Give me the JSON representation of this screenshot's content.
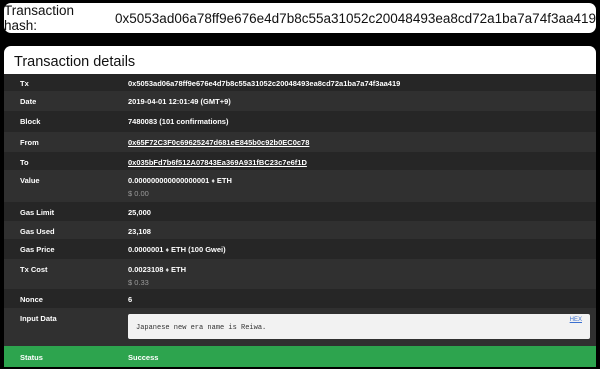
{
  "header": {
    "label": "Transaction hash:",
    "hash": "0x5053ad06a78ff9e676e4d7b8c55a31052c20048493ea8cd72a1ba7a74f3aa419"
  },
  "panel": {
    "title": "Transaction details",
    "rows": {
      "tx": {
        "label": "Tx",
        "value": "0x5053ad06a78ff9e676e4d7b8c55a31052c20048493ea8cd72a1ba7a74f3aa419"
      },
      "date": {
        "label": "Date",
        "value": "2019-04-01 12:01:49 (GMT+9)"
      },
      "block": {
        "label": "Block",
        "value": "7480083 (101 confirmations)"
      },
      "from": {
        "label": "From",
        "value": "0x65F72C3F0c69625247d681eE845b0c92b0EC0c78"
      },
      "to": {
        "label": "To",
        "value": "0x035bFd7b6f512A07843Ea369A931fBC23c7e6f1D"
      },
      "value": {
        "label": "Value",
        "amount": "0.000000000000000001",
        "unit": "ETH",
        "usd": "$ 0.00"
      },
      "gas_limit": {
        "label": "Gas Limit",
        "value": "25,000"
      },
      "gas_used": {
        "label": "Gas Used",
        "value": "23,108"
      },
      "gas_price": {
        "label": "Gas Price",
        "amount": "0.0000001",
        "unit": "ETH (100 Gwei)"
      },
      "tx_cost": {
        "label": "Tx Cost",
        "amount": "0.0023108",
        "unit": "ETH",
        "usd": "$ 0.33"
      },
      "nonce": {
        "label": "Nonce",
        "value": "6"
      },
      "input_data": {
        "label": "Input Data",
        "value": "Japanese new era name is Reiwa.",
        "hex_label": "HEX"
      },
      "status": {
        "label": "Status",
        "value": "Success"
      }
    },
    "icons": {
      "eth": "ethereum-diamond-icon"
    },
    "colors": {
      "status_success": "#2da44e",
      "row_dark": "#262626",
      "row_mid": "#303030"
    }
  }
}
